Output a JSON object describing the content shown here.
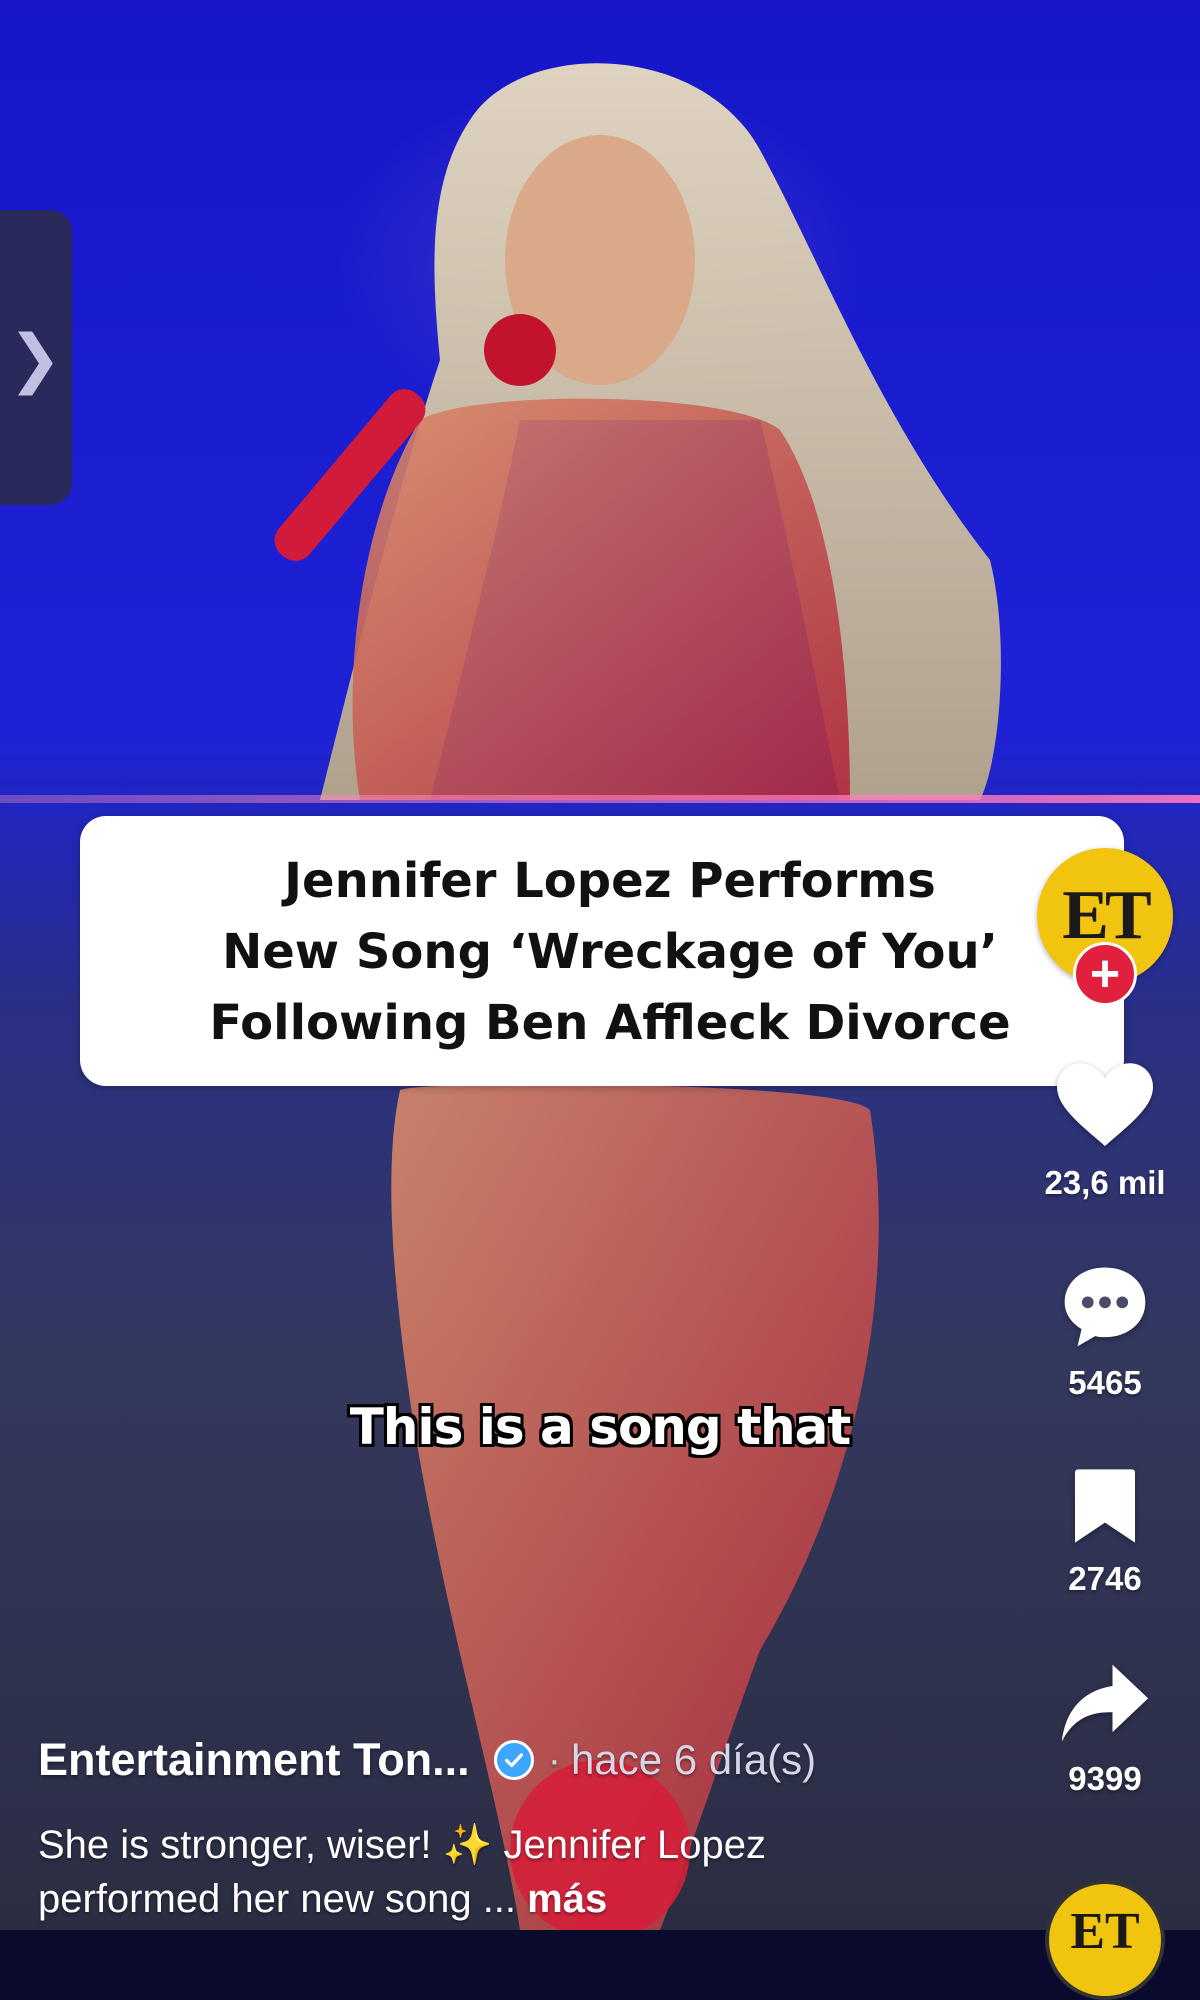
{
  "headline": {
    "line1": "Jennifer Lopez Performs",
    "line2": "New Song ‘Wreckage of You’",
    "line3": "Following Ben Affleck Divorce"
  },
  "creator": {
    "avatar_text": "ET",
    "follow_symbol": "+",
    "name": "Entertainment Ton...",
    "separator": "·",
    "time": "hace 6 día(s)"
  },
  "side_tab": {
    "icon": "chevron-right-icon",
    "glyph": "❯"
  },
  "actions": {
    "likes": "23,6 mil",
    "comments": "5465",
    "saves": "2746",
    "shares": "9399"
  },
  "subtitle": "This is a song that",
  "description": {
    "text_before": "She is stronger, wiser! ",
    "sparkle": "✨",
    "text_after": " Jennifer Lopez performed her new song ... ",
    "more_label": "más"
  },
  "music": {
    "disc_text": "ET"
  },
  "colors": {
    "follow_red": "#e0203c",
    "avatar_yellow": "#f1c40f",
    "verified_blue": "#3da7ff"
  }
}
